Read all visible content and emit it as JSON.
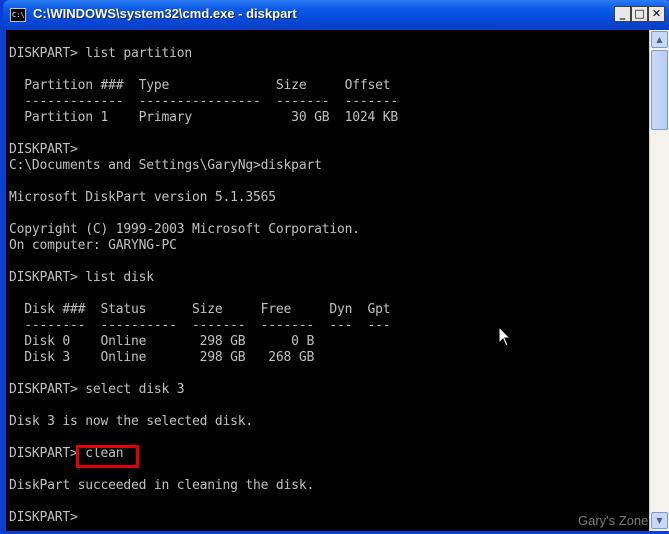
{
  "window": {
    "title": "C:\\WINDOWS\\system32\\cmd.exe - diskpart",
    "icon_text": "C:\\",
    "buttons": {
      "minimize": "_",
      "maximize": "□",
      "close": "✕"
    }
  },
  "console": {
    "lines": [
      "DISKPART> list partition",
      "",
      "  Partition ###  Type              Size     Offset",
      "  -------------  ----------------  -------  -------",
      "  Partition 1    Primary             30 GB  1024 KB",
      "",
      "DISKPART>",
      "C:\\Documents and Settings\\GaryNg>diskpart",
      "",
      "Microsoft DiskPart version 5.1.3565",
      "",
      "Copyright (C) 1999-2003 Microsoft Corporation.",
      "On computer: GARYNG-PC",
      "",
      "DISKPART> list disk",
      "",
      "  Disk ###  Status      Size     Free     Dyn  Gpt",
      "  --------  ----------  -------  -------  ---  ---",
      "  Disk 0    Online       298 GB      0 B",
      "  Disk 3    Online       298 GB   268 GB",
      "",
      "DISKPART> select disk 3",
      "",
      "Disk 3 is now the selected disk.",
      "",
      "DISKPART> clean",
      "",
      "DiskPart succeeded in cleaning the disk.",
      "",
      "DISKPART>"
    ]
  },
  "scrollbar": {
    "up_arrow": "▲",
    "down_arrow": "▼"
  },
  "watermark": "Gary's Zone"
}
